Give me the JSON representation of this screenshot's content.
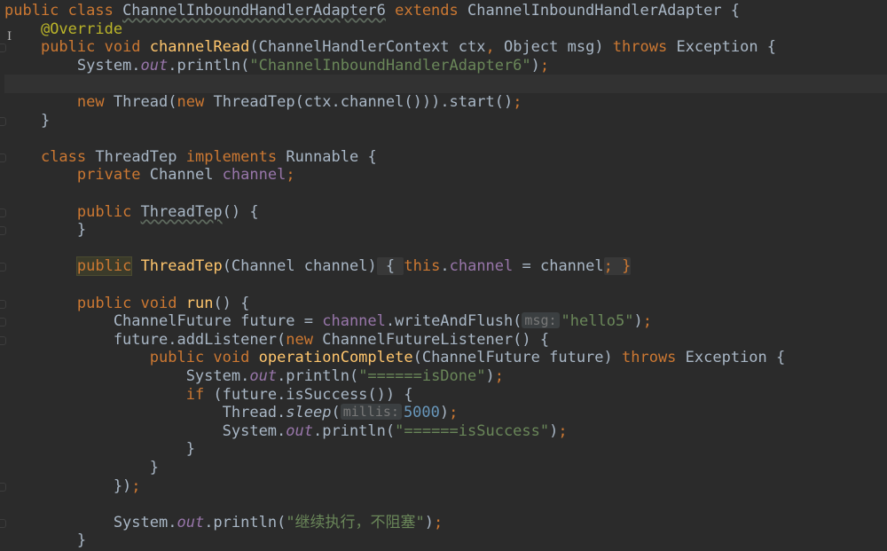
{
  "editor": {
    "language": "Java",
    "colors": {
      "background": "#2b2b2b",
      "keyword": "#cc7832",
      "method_declaration": "#ffc66d",
      "string": "#6a8759",
      "annotation": "#bbb529",
      "field": "#9876aa",
      "number": "#6897bb",
      "default_text": "#a9b7c6",
      "parameter_hint_bg": "#3b3f41"
    },
    "lines": [
      {
        "tokens": [
          {
            "t": "public class ",
            "c": "kw"
          },
          {
            "t": "ChannelInboundHandlerAdapter6",
            "c": "wavy"
          },
          {
            "t": " extends ",
            "c": "kw"
          },
          {
            "t": "ChannelInboundHandlerAdapter {",
            "c": ""
          }
        ]
      },
      {
        "tokens": [
          {
            "t": "    ",
            "c": ""
          },
          {
            "t": "@Override",
            "c": "ann"
          }
        ]
      },
      {
        "tokens": [
          {
            "t": "    ",
            "c": ""
          },
          {
            "t": "public void ",
            "c": "kw"
          },
          {
            "t": "channelRead",
            "c": "fn"
          },
          {
            "t": "(ChannelHandlerContext ctx",
            "c": ""
          },
          {
            "t": ", ",
            "c": "kw"
          },
          {
            "t": "Object msg) ",
            "c": ""
          },
          {
            "t": "throws ",
            "c": "kw"
          },
          {
            "t": "Exception {",
            "c": ""
          }
        ]
      },
      {
        "tokens": [
          {
            "t": "        System.",
            "c": ""
          },
          {
            "t": "out",
            "c": "fld-i"
          },
          {
            "t": ".println(",
            "c": ""
          },
          {
            "t": "\"ChannelInboundHandlerAdapter6\"",
            "c": "str"
          },
          {
            "t": ")",
            "c": ""
          },
          {
            "t": ";",
            "c": "kw"
          }
        ]
      },
      {
        "tokens": [],
        "current": true
      },
      {
        "tokens": [
          {
            "t": "        ",
            "c": ""
          },
          {
            "t": "new ",
            "c": "kw"
          },
          {
            "t": "Thread(",
            "c": ""
          },
          {
            "t": "new ",
            "c": "kw"
          },
          {
            "t": "ThreadTep(ctx.channel())).start()",
            "c": ""
          },
          {
            "t": ";",
            "c": "kw"
          }
        ]
      },
      {
        "tokens": [
          {
            "t": "    }",
            "c": ""
          }
        ]
      },
      {
        "tokens": []
      },
      {
        "tokens": [
          {
            "t": "    ",
            "c": ""
          },
          {
            "t": "class ",
            "c": "kw"
          },
          {
            "t": "ThreadTep ",
            "c": ""
          },
          {
            "t": "implements ",
            "c": "kw"
          },
          {
            "t": "Runnable {",
            "c": ""
          }
        ]
      },
      {
        "tokens": [
          {
            "t": "        ",
            "c": ""
          },
          {
            "t": "private ",
            "c": "kw"
          },
          {
            "t": "Channel ",
            "c": ""
          },
          {
            "t": "channel",
            "c": "fld"
          },
          {
            "t": ";",
            "c": "kw"
          }
        ]
      },
      {
        "tokens": []
      },
      {
        "tokens": [
          {
            "t": "        ",
            "c": ""
          },
          {
            "t": "public ",
            "c": "kw"
          },
          {
            "t": "ThreadTep",
            "c": "wavy"
          },
          {
            "t": "() {",
            "c": ""
          }
        ]
      },
      {
        "tokens": [
          {
            "t": "        }",
            "c": ""
          }
        ]
      },
      {
        "tokens": []
      },
      {
        "tokens": [
          {
            "t": "        ",
            "c": ""
          },
          {
            "t": "public",
            "c": "kw hl-box"
          },
          {
            "t": " ",
            "c": ""
          },
          {
            "t": "ThreadTep",
            "c": "fn"
          },
          {
            "t": "(Channel channel)",
            "c": ""
          },
          {
            "t": " { ",
            "c": "fold-bg"
          },
          {
            "t": "this",
            "c": "kw"
          },
          {
            "t": ".",
            "c": ""
          },
          {
            "t": "channel",
            "c": "fld"
          },
          {
            "t": " = channel",
            "c": ""
          },
          {
            "t": "; }",
            "c": "kw fold-bg"
          }
        ]
      },
      {
        "tokens": []
      },
      {
        "tokens": [
          {
            "t": "        ",
            "c": ""
          },
          {
            "t": "public void ",
            "c": "kw"
          },
          {
            "t": "run",
            "c": "fn"
          },
          {
            "t": "() {",
            "c": ""
          }
        ]
      },
      {
        "tokens": [
          {
            "t": "            ChannelFuture future = ",
            "c": ""
          },
          {
            "t": "channel",
            "c": "fld"
          },
          {
            "t": ".writeAndFlush(",
            "c": ""
          },
          {
            "t": "msg:",
            "c": "hint"
          },
          {
            "t": "\"hello5\"",
            "c": "str"
          },
          {
            "t": ")",
            "c": ""
          },
          {
            "t": ";",
            "c": "kw"
          }
        ]
      },
      {
        "tokens": [
          {
            "t": "            future.addListener(",
            "c": ""
          },
          {
            "t": "new ",
            "c": "kw"
          },
          {
            "t": "ChannelFutureListener() {",
            "c": ""
          }
        ]
      },
      {
        "tokens": [
          {
            "t": "                ",
            "c": ""
          },
          {
            "t": "public void ",
            "c": "kw"
          },
          {
            "t": "operationComplete",
            "c": "fn"
          },
          {
            "t": "(ChannelFuture future) ",
            "c": ""
          },
          {
            "t": "throws ",
            "c": "kw"
          },
          {
            "t": "Exception {",
            "c": ""
          }
        ]
      },
      {
        "tokens": [
          {
            "t": "                    System.",
            "c": ""
          },
          {
            "t": "out",
            "c": "fld-i"
          },
          {
            "t": ".println(",
            "c": ""
          },
          {
            "t": "\"======isDone\"",
            "c": "str"
          },
          {
            "t": ")",
            "c": ""
          },
          {
            "t": ";",
            "c": "kw"
          }
        ]
      },
      {
        "tokens": [
          {
            "t": "                    ",
            "c": ""
          },
          {
            "t": "if ",
            "c": "kw"
          },
          {
            "t": "(future.isSuccess()) {",
            "c": ""
          }
        ]
      },
      {
        "tokens": [
          {
            "t": "                        Thread.",
            "c": ""
          },
          {
            "t": "sleep",
            "c": "static-m"
          },
          {
            "t": "(",
            "c": ""
          },
          {
            "t": "millis:",
            "c": "hint"
          },
          {
            "t": "5000",
            "c": "num"
          },
          {
            "t": ")",
            "c": ""
          },
          {
            "t": ";",
            "c": "kw"
          }
        ]
      },
      {
        "tokens": [
          {
            "t": "                        System.",
            "c": ""
          },
          {
            "t": "out",
            "c": "fld-i"
          },
          {
            "t": ".println(",
            "c": ""
          },
          {
            "t": "\"======isSuccess\"",
            "c": "str"
          },
          {
            "t": ")",
            "c": ""
          },
          {
            "t": ";",
            "c": "kw"
          }
        ]
      },
      {
        "tokens": [
          {
            "t": "                    }",
            "c": ""
          }
        ]
      },
      {
        "tokens": [
          {
            "t": "                }",
            "c": ""
          }
        ]
      },
      {
        "tokens": [
          {
            "t": "            })",
            "c": ""
          },
          {
            "t": ";",
            "c": "kw"
          }
        ]
      },
      {
        "tokens": []
      },
      {
        "tokens": [
          {
            "t": "            System.",
            "c": ""
          },
          {
            "t": "out",
            "c": "fld-i"
          },
          {
            "t": ".println(",
            "c": ""
          },
          {
            "t": "\"继续执行，不阻塞\"",
            "c": "str"
          },
          {
            "t": ")",
            "c": ""
          },
          {
            "t": ";",
            "c": "kw"
          }
        ]
      },
      {
        "tokens": [
          {
            "t": "        }",
            "c": ""
          }
        ]
      }
    ]
  }
}
